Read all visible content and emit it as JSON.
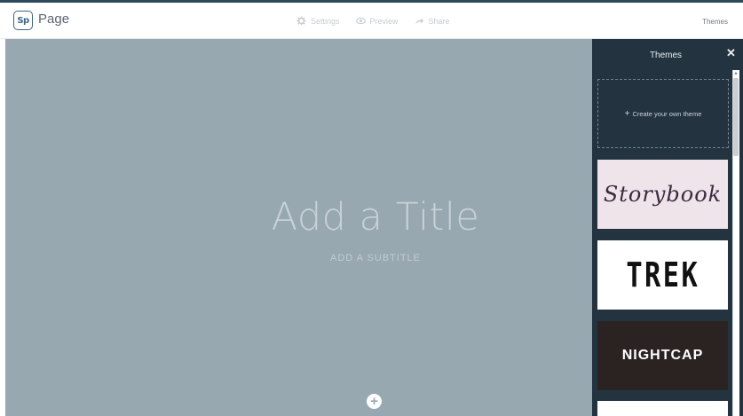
{
  "app": {
    "logo_badge": "Sp",
    "logo_text": "Page"
  },
  "topnav": {
    "settings_label": "Settings",
    "preview_label": "Preview",
    "share_label": "Share",
    "themes_label": "Themes",
    "icons": [
      "gear-icon",
      "eye-icon",
      "share-arrow-icon"
    ]
  },
  "canvas": {
    "title_placeholder": "Add a Title",
    "subtitle_placeholder": "ADD A SUBTITLE",
    "add_button": "+"
  },
  "themes_panel": {
    "title": "Themes",
    "close": "✕",
    "create_label": "Create your own theme",
    "themes": [
      {
        "name": "Storybook"
      },
      {
        "name": "TREK"
      },
      {
        "name": "NIGHTCAP"
      }
    ]
  },
  "colors": {
    "canvas_bg": "#98a8b1",
    "panel_bg": "#233440",
    "accent": "#2d4a5c"
  }
}
